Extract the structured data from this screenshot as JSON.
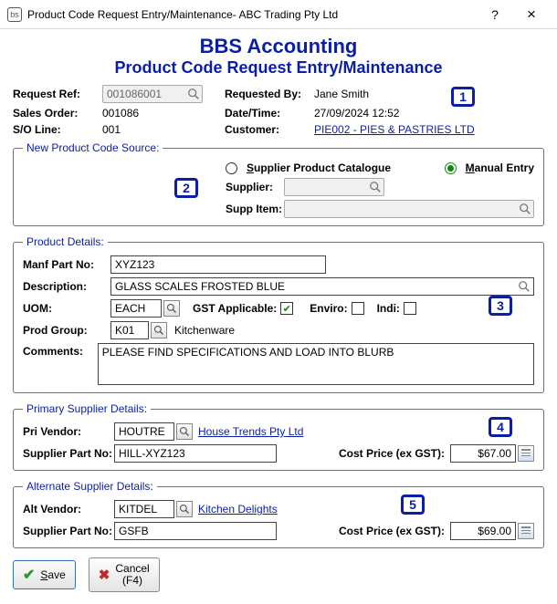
{
  "window": {
    "title": "Product Code Request Entry/Maintenance- ABC Trading Pty Ltd",
    "help": "?",
    "close": "×",
    "icon_label": "bs"
  },
  "heading": {
    "app": "BBS Accounting",
    "screen": "Product Code Request Entry/Maintenance"
  },
  "header": {
    "request_ref_label": "Request Ref:",
    "request_ref": "001086001",
    "sales_order_label": "Sales Order:",
    "sales_order": "001086",
    "so_line_label": "S/O Line:",
    "so_line": "001",
    "requested_by_label": "Requested By:",
    "requested_by": "Jane Smith",
    "datetime_label": "Date/Time:",
    "datetime": "27/09/2024 12:52",
    "customer_label": "Customer:",
    "customer": "PIE002 - PIES & PASTRIES LTD"
  },
  "callouts": {
    "n1": "1",
    "n2": "2",
    "n3": "3",
    "n4": "4",
    "n5": "5"
  },
  "source": {
    "legend": "New Product Code Source:",
    "opt_catalogue": "upplier Product Catalogue",
    "opt_catalogue_accel": "S",
    "opt_manual": "anual Entry",
    "opt_manual_accel": "M",
    "supplier_label": "Supplier:",
    "supplier": "",
    "supp_item_label": "Supp Item:",
    "supp_item": ""
  },
  "product": {
    "legend": "Product Details:",
    "manf_label": "Manf Part No:",
    "manf": "XYZ123",
    "desc_label": "Description:",
    "desc": "GLASS SCALES FROSTED BLUE",
    "uom_label": "UOM:",
    "uom": "EACH",
    "gst_label": "GST Applicable:",
    "gst_checked": true,
    "enviro_label": "Enviro:",
    "indi_label": "Indi:",
    "prodgroup_label": "Prod Group:",
    "prodgroup": "K01",
    "prodgroup_desc": "Kitchenware",
    "comments_label": "Comments:",
    "comments": "PLEASE FIND SPECIFICATIONS AND LOAD INTO BLURB"
  },
  "primary": {
    "legend": "Primary Supplier Details:",
    "pri_vendor_label": "Pri Vendor:",
    "pri_vendor": "HOUTRE",
    "pri_vendor_name": "House Trends Pty Ltd",
    "part_label": "Supplier Part No:",
    "part": "HILL-XYZ123",
    "cost_label": "Cost Price (ex GST):",
    "cost": "$67.00"
  },
  "alternate": {
    "legend": "Alternate Supplier Details:",
    "alt_vendor_label": "Alt Vendor:",
    "alt_vendor": "KITDEL",
    "alt_vendor_name": "Kitchen Delights",
    "part_label": "Supplier Part No:",
    "part": "GSFB",
    "cost_label": "Cost Price (ex GST):",
    "cost": "$69.00"
  },
  "buttons": {
    "save_accel": "S",
    "save_rest": "ave",
    "cancel": "Cancel",
    "cancel_hint": "(F4)"
  }
}
